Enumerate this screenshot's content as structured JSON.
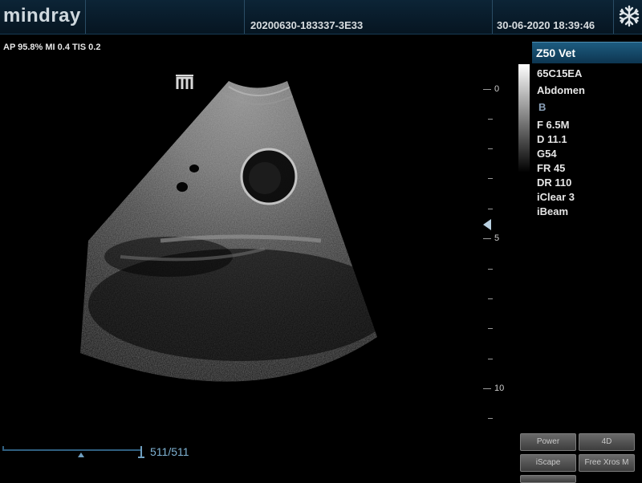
{
  "header": {
    "logo": "mindray",
    "patient_id": "20200630-183337-3E33",
    "datetime": "30-06-2020  18:39:46",
    "freeze_icon": "snowflake-icon"
  },
  "acoustic_output": "AP 95.8%  MI 0.4 TIS 0.2",
  "depth_scale": {
    "labels": [
      "0",
      "5",
      "10"
    ],
    "focus_marker_icon": "triangle-left-icon"
  },
  "panel": {
    "model": "Z50 Vet",
    "probe": "65C15EA",
    "exam": "Abdomen",
    "mode": "B",
    "params": [
      "F 6.5M",
      "D 11.1",
      "G54",
      "FR 45",
      "DR 110",
      "iClear 3",
      "iBeam"
    ]
  },
  "cine": {
    "frame": "511/511"
  },
  "soft_buttons": [
    "Power",
    "4D",
    "iScape",
    "Free Xros M"
  ],
  "colors": {
    "header_bg": "#0c2436",
    "accent_blue": "#1d5c80",
    "cine_blue": "#7fb3d4"
  }
}
